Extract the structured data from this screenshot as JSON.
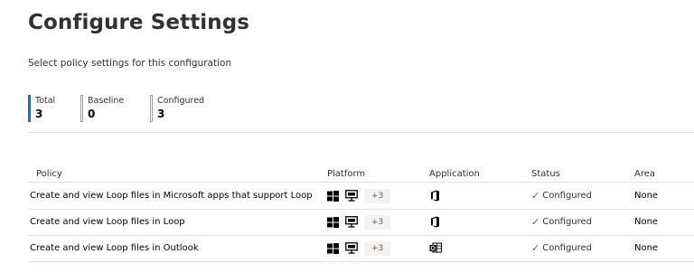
{
  "page": {
    "title": "Configure Settings",
    "subtitle": "Select policy settings for this configuration"
  },
  "stats": [
    {
      "label": "Total",
      "value": "3"
    },
    {
      "label": "Baseline",
      "value": "0"
    },
    {
      "label": "Configured",
      "value": "3"
    }
  ],
  "table": {
    "headers": {
      "policy": "Policy",
      "platform": "Platform",
      "application": "Application",
      "status": "Status",
      "area": "Area"
    },
    "rows": [
      {
        "policy": "Create and view Loop files in Microsoft apps that support Loop",
        "platform_more": "+3",
        "application_icon": "office-icon",
        "status": "Configured",
        "area": "None"
      },
      {
        "policy": "Create and view Loop files in Loop",
        "platform_more": "+3",
        "application_icon": "office-icon",
        "status": "Configured",
        "area": "None"
      },
      {
        "policy": "Create and view Loop files in Outlook",
        "platform_more": "+3",
        "application_icon": "outlook-icon",
        "status": "Configured",
        "area": "None"
      }
    ]
  },
  "colors": {
    "accent": "#0078d4",
    "text": "#323130",
    "border": "#e1dfdd"
  }
}
